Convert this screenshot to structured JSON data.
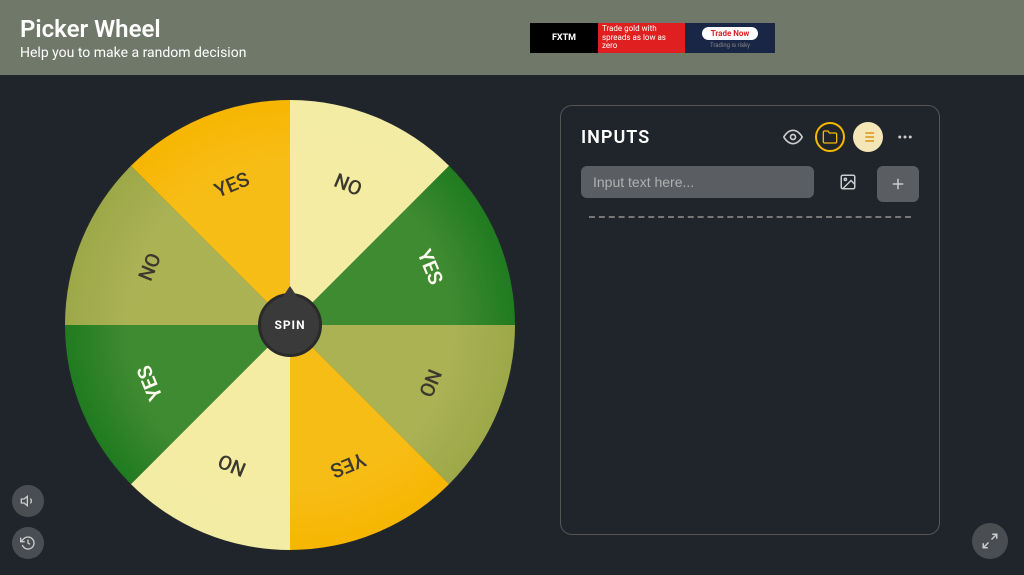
{
  "header": {
    "title": "Picker Wheel",
    "subtitle": "Help you to make a random decision"
  },
  "ad": {
    "brand": "FXTM",
    "text": "Trade gold with spreads as low as zero",
    "cta": "Trade Now",
    "disclaimer": "Trading is risky"
  },
  "wheel": {
    "spin_label": "SPIN",
    "slices": [
      {
        "label": "YES",
        "color": "#f7b500"
      },
      {
        "label": "NO",
        "color": "#f3eca5"
      },
      {
        "label": "YES",
        "color": "#1f7a1f"
      },
      {
        "label": "NO",
        "color": "#9ca848"
      },
      {
        "label": "YES",
        "color": "#f7b500"
      },
      {
        "label": "NO",
        "color": "#f3eca5"
      },
      {
        "label": "YES",
        "color": "#1f7a1f"
      },
      {
        "label": "NO",
        "color": "#9ca848"
      }
    ]
  },
  "inputs": {
    "title": "INPUTS",
    "placeholder": "Input text here..."
  }
}
